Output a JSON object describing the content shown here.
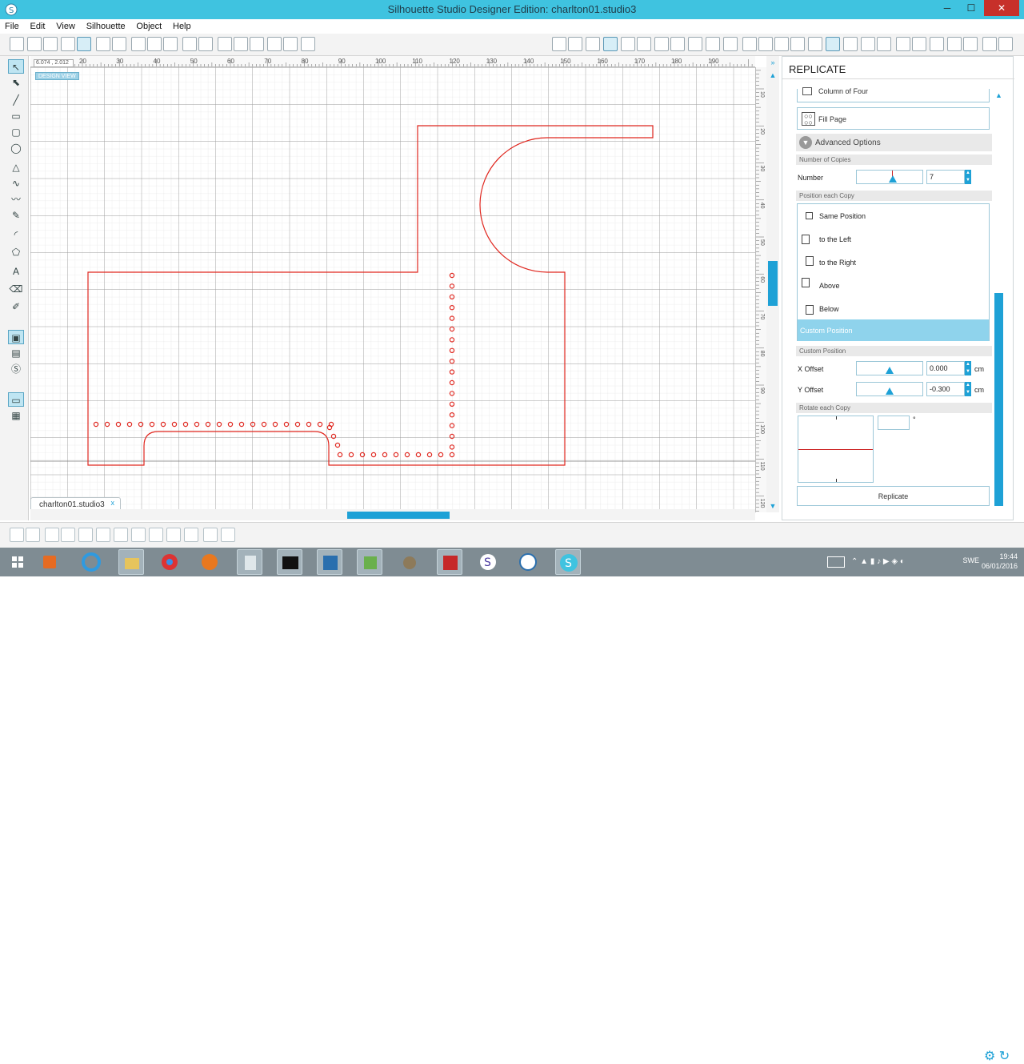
{
  "window": {
    "title": "Silhouette Studio Designer Edition: charlton01.studio3",
    "min_glyph": "─",
    "max_glyph": "☐",
    "close_glyph": "✕"
  },
  "menu": [
    "File",
    "Edit",
    "View",
    "Silhouette",
    "Object",
    "Help"
  ],
  "canvas": {
    "coord_readout": "6.074 , 2.012",
    "design_view_label": "DESIGN VIEW",
    "ruler_top": [
      "20",
      "30",
      "40",
      "50",
      "60",
      "70",
      "80",
      "90",
      "100",
      "110",
      "120",
      "130",
      "140",
      "150",
      "160",
      "170",
      "180",
      "190"
    ],
    "ruler_right": [
      "10",
      "20",
      "30",
      "40",
      "50",
      "60",
      "70",
      "80",
      "90",
      "100",
      "110",
      "120"
    ],
    "shape_color": "#e0271f"
  },
  "document_tab": {
    "name": "charlton01.studio3",
    "close_glyph": "x"
  },
  "panel": {
    "title": "REPLICATE",
    "column_of_four_label": "Column of Four",
    "fill_page_label": "Fill Page",
    "advanced_options_label": "Advanced Options",
    "number_of_copies_section": "Number of Copies",
    "number_label": "Number",
    "number_value": "7",
    "position_section": "Position each Copy",
    "positions": [
      "Same Position",
      "to the Left",
      "to the Right",
      "Above",
      "Below"
    ],
    "custom_position_label": "Custom Position",
    "custom_position_section": "Custom Position",
    "x_offset_label": "X Offset",
    "x_offset_value": "0.000",
    "y_offset_label": "Y Offset",
    "y_offset_value": "-0.300",
    "unit": "cm",
    "rotate_section": "Rotate each Copy",
    "rotate_degree_symbol": "°",
    "replicate_button": "Replicate",
    "accent_color": "#1ea1d6",
    "selected_color": "#8fd3ec"
  },
  "taskbar": {
    "language": "SWE",
    "time": "19:44",
    "date": "06/01/2016",
    "apps": [
      "start-icon",
      "media-player-icon",
      "internet-explorer-icon",
      "file-explorer-icon",
      "chrome-icon",
      "firefox-icon",
      "calculator-icon",
      "command-prompt-icon",
      "text-tool-icon",
      "chart-app-icon",
      "gimp-icon",
      "filezilla-icon",
      "silhouette-s-icon",
      "update-app-icon",
      "silhouette-studio-icon"
    ]
  }
}
